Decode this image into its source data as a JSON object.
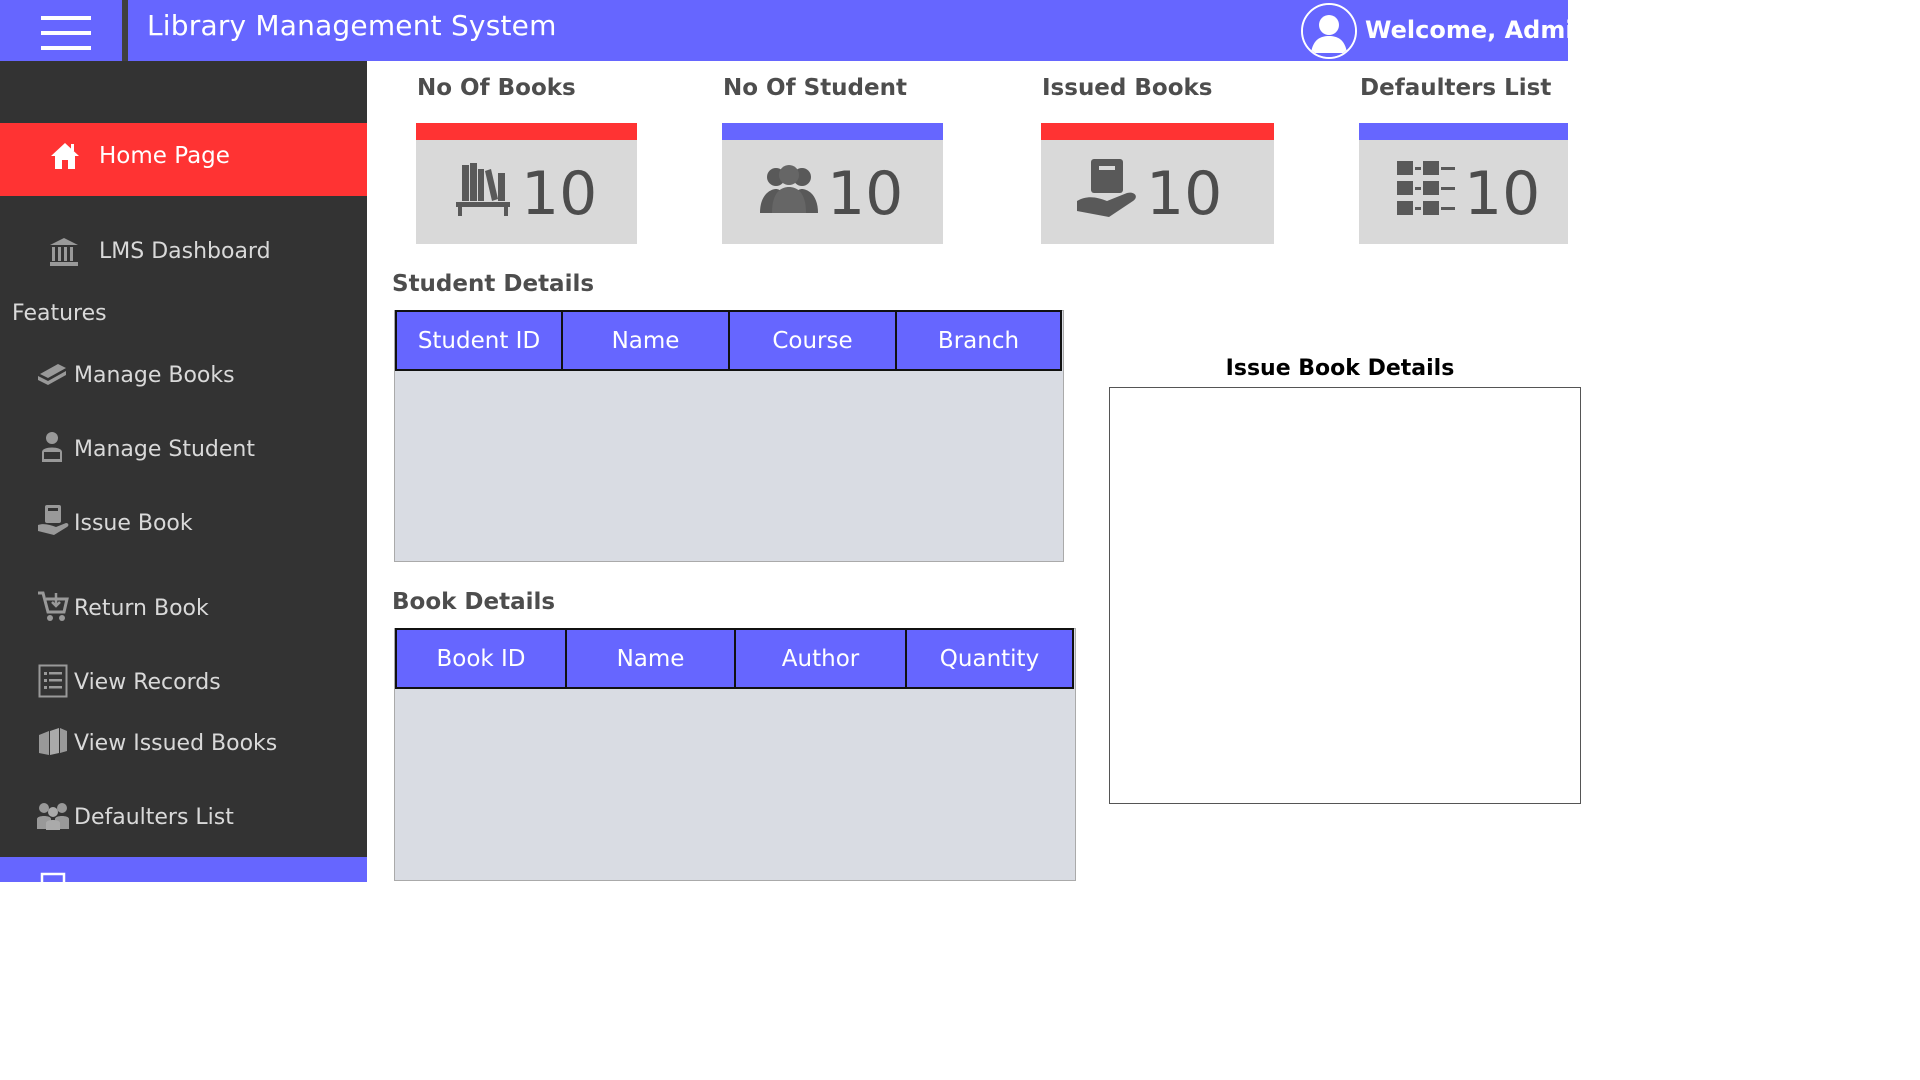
{
  "header": {
    "title": "Library Management System",
    "welcome": "Welcome, Admin",
    "menu_icon": "hamburger-menu-icon",
    "avatar_icon": "user-avatar-icon"
  },
  "sidebar": {
    "home": {
      "label": "Home Page",
      "icon": "home-icon"
    },
    "dashboard": {
      "label": "LMS Dashboard",
      "icon": "bank-icon"
    },
    "features_heading": "Features",
    "items": [
      {
        "label": "Manage Books",
        "icon": "book-icon"
      },
      {
        "label": "Manage Student",
        "icon": "student-icon"
      },
      {
        "label": "Issue Book",
        "icon": "issue-book-icon"
      },
      {
        "label": "Return Book",
        "icon": "cart-icon"
      },
      {
        "label": "View Records",
        "icon": "list-icon"
      },
      {
        "label": "View Issued Books",
        "icon": "books-stack-icon"
      },
      {
        "label": "Defaulters List",
        "icon": "group-icon"
      }
    ]
  },
  "cards": [
    {
      "title": "No Of Books",
      "value": "10",
      "icon": "books-shelf-icon",
      "color": "#ff3333"
    },
    {
      "title": "No Of Student",
      "value": "10",
      "icon": "people-icon",
      "color": "#6666ff"
    },
    {
      "title": "Issued Books",
      "value": "10",
      "icon": "hand-book-icon",
      "color": "#ff3333"
    },
    {
      "title": "Defaulters List",
      "value": "10",
      "icon": "checklist-icon",
      "color": "#6666ff"
    }
  ],
  "student_details": {
    "title": "Student Details",
    "columns": [
      "Student ID",
      "Name",
      "Course",
      "Branch"
    ]
  },
  "book_details": {
    "title": "Book Details",
    "columns": [
      "Book ID",
      "Name",
      "Author",
      "Quantity"
    ]
  },
  "issue_book_details": {
    "title": "Issue Book Details"
  },
  "colors": {
    "accent": "#6666ff",
    "active": "#ff3333",
    "sidebar": "#333333",
    "card": "#d9d9d9"
  }
}
